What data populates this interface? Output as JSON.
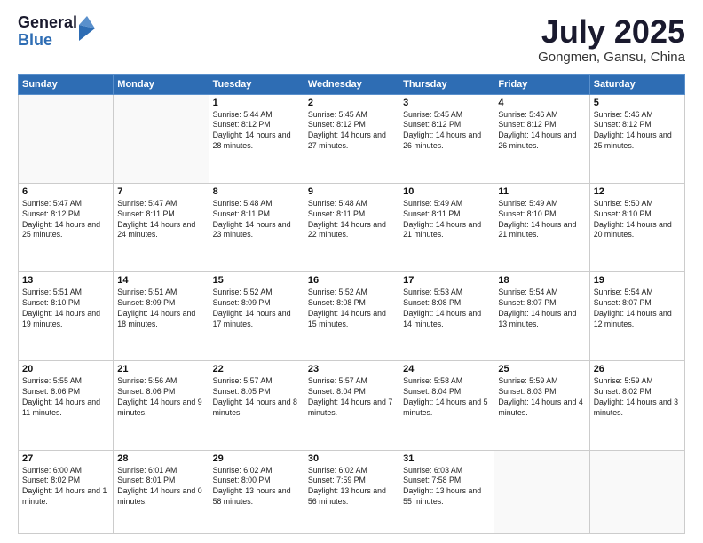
{
  "logo": {
    "general": "General",
    "blue": "Blue"
  },
  "title": "July 2025",
  "location": "Gongmen, Gansu, China",
  "days_of_week": [
    "Sunday",
    "Monday",
    "Tuesday",
    "Wednesday",
    "Thursday",
    "Friday",
    "Saturday"
  ],
  "weeks": [
    [
      {
        "day": "",
        "info": ""
      },
      {
        "day": "",
        "info": ""
      },
      {
        "day": "1",
        "info": "Sunrise: 5:44 AM\nSunset: 8:12 PM\nDaylight: 14 hours and 28 minutes."
      },
      {
        "day": "2",
        "info": "Sunrise: 5:45 AM\nSunset: 8:12 PM\nDaylight: 14 hours and 27 minutes."
      },
      {
        "day": "3",
        "info": "Sunrise: 5:45 AM\nSunset: 8:12 PM\nDaylight: 14 hours and 26 minutes."
      },
      {
        "day": "4",
        "info": "Sunrise: 5:46 AM\nSunset: 8:12 PM\nDaylight: 14 hours and 26 minutes."
      },
      {
        "day": "5",
        "info": "Sunrise: 5:46 AM\nSunset: 8:12 PM\nDaylight: 14 hours and 25 minutes."
      }
    ],
    [
      {
        "day": "6",
        "info": "Sunrise: 5:47 AM\nSunset: 8:12 PM\nDaylight: 14 hours and 25 minutes."
      },
      {
        "day": "7",
        "info": "Sunrise: 5:47 AM\nSunset: 8:11 PM\nDaylight: 14 hours and 24 minutes."
      },
      {
        "day": "8",
        "info": "Sunrise: 5:48 AM\nSunset: 8:11 PM\nDaylight: 14 hours and 23 minutes."
      },
      {
        "day": "9",
        "info": "Sunrise: 5:48 AM\nSunset: 8:11 PM\nDaylight: 14 hours and 22 minutes."
      },
      {
        "day": "10",
        "info": "Sunrise: 5:49 AM\nSunset: 8:11 PM\nDaylight: 14 hours and 21 minutes."
      },
      {
        "day": "11",
        "info": "Sunrise: 5:49 AM\nSunset: 8:10 PM\nDaylight: 14 hours and 21 minutes."
      },
      {
        "day": "12",
        "info": "Sunrise: 5:50 AM\nSunset: 8:10 PM\nDaylight: 14 hours and 20 minutes."
      }
    ],
    [
      {
        "day": "13",
        "info": "Sunrise: 5:51 AM\nSunset: 8:10 PM\nDaylight: 14 hours and 19 minutes."
      },
      {
        "day": "14",
        "info": "Sunrise: 5:51 AM\nSunset: 8:09 PM\nDaylight: 14 hours and 18 minutes."
      },
      {
        "day": "15",
        "info": "Sunrise: 5:52 AM\nSunset: 8:09 PM\nDaylight: 14 hours and 17 minutes."
      },
      {
        "day": "16",
        "info": "Sunrise: 5:52 AM\nSunset: 8:08 PM\nDaylight: 14 hours and 15 minutes."
      },
      {
        "day": "17",
        "info": "Sunrise: 5:53 AM\nSunset: 8:08 PM\nDaylight: 14 hours and 14 minutes."
      },
      {
        "day": "18",
        "info": "Sunrise: 5:54 AM\nSunset: 8:07 PM\nDaylight: 14 hours and 13 minutes."
      },
      {
        "day": "19",
        "info": "Sunrise: 5:54 AM\nSunset: 8:07 PM\nDaylight: 14 hours and 12 minutes."
      }
    ],
    [
      {
        "day": "20",
        "info": "Sunrise: 5:55 AM\nSunset: 8:06 PM\nDaylight: 14 hours and 11 minutes."
      },
      {
        "day": "21",
        "info": "Sunrise: 5:56 AM\nSunset: 8:06 PM\nDaylight: 14 hours and 9 minutes."
      },
      {
        "day": "22",
        "info": "Sunrise: 5:57 AM\nSunset: 8:05 PM\nDaylight: 14 hours and 8 minutes."
      },
      {
        "day": "23",
        "info": "Sunrise: 5:57 AM\nSunset: 8:04 PM\nDaylight: 14 hours and 7 minutes."
      },
      {
        "day": "24",
        "info": "Sunrise: 5:58 AM\nSunset: 8:04 PM\nDaylight: 14 hours and 5 minutes."
      },
      {
        "day": "25",
        "info": "Sunrise: 5:59 AM\nSunset: 8:03 PM\nDaylight: 14 hours and 4 minutes."
      },
      {
        "day": "26",
        "info": "Sunrise: 5:59 AM\nSunset: 8:02 PM\nDaylight: 14 hours and 3 minutes."
      }
    ],
    [
      {
        "day": "27",
        "info": "Sunrise: 6:00 AM\nSunset: 8:02 PM\nDaylight: 14 hours and 1 minute."
      },
      {
        "day": "28",
        "info": "Sunrise: 6:01 AM\nSunset: 8:01 PM\nDaylight: 14 hours and 0 minutes."
      },
      {
        "day": "29",
        "info": "Sunrise: 6:02 AM\nSunset: 8:00 PM\nDaylight: 13 hours and 58 minutes."
      },
      {
        "day": "30",
        "info": "Sunrise: 6:02 AM\nSunset: 7:59 PM\nDaylight: 13 hours and 56 minutes."
      },
      {
        "day": "31",
        "info": "Sunrise: 6:03 AM\nSunset: 7:58 PM\nDaylight: 13 hours and 55 minutes."
      },
      {
        "day": "",
        "info": ""
      },
      {
        "day": "",
        "info": ""
      }
    ]
  ]
}
